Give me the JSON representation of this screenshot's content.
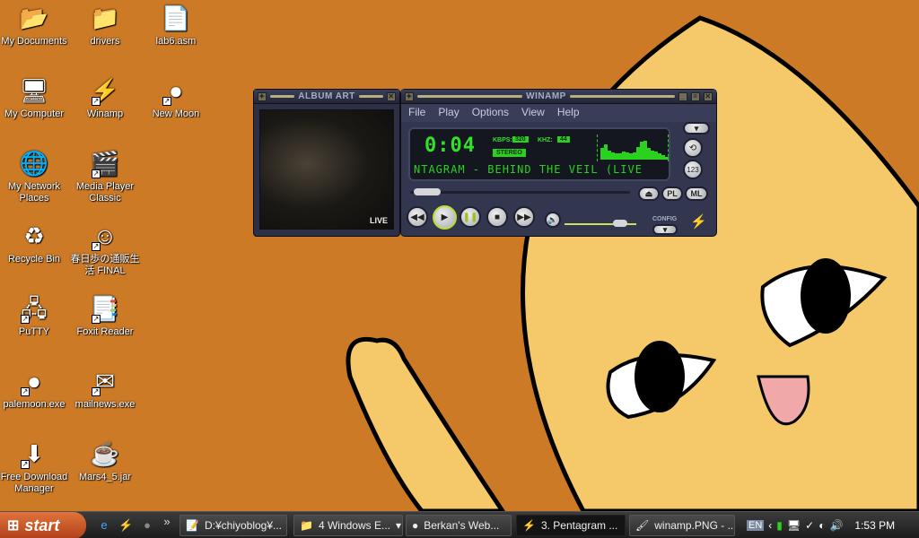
{
  "desktop": {
    "icons": [
      {
        "label": "My Documents",
        "icon": "my-documents-icon",
        "glyph": "📂",
        "shortcut": false
      },
      {
        "label": "drivers",
        "icon": "folder-icon",
        "glyph": "📁",
        "shortcut": false
      },
      {
        "label": "lab6.asm",
        "icon": "text-file-icon",
        "glyph": "📄",
        "shortcut": false
      },
      {
        "label": "My Computer",
        "icon": "my-computer-icon",
        "glyph": "🖥",
        "shortcut": false
      },
      {
        "label": "Winamp",
        "icon": "winamp-icon",
        "glyph": "⚡",
        "shortcut": true
      },
      {
        "label": "New Moon",
        "icon": "new-moon-icon",
        "glyph": "●",
        "shortcut": true
      },
      {
        "label": "My Network Places",
        "icon": "network-places-icon",
        "glyph": "🌐",
        "shortcut": false
      },
      {
        "label": "Media Player Classic",
        "icon": "media-player-classic-icon",
        "glyph": "🎬",
        "shortcut": true
      },
      {
        "label": "Recycle Bin",
        "icon": "recycle-bin-icon",
        "glyph": "♻",
        "shortcut": false
      },
      {
        "label": "春日歩の通販生活 FINAL",
        "icon": "anime-app-icon",
        "glyph": "☺",
        "shortcut": true
      },
      {
        "label": "PuTTY",
        "icon": "putty-icon",
        "glyph": "🖧",
        "shortcut": true
      },
      {
        "label": "Foxit Reader",
        "icon": "foxit-reader-icon",
        "glyph": "📑",
        "shortcut": true
      },
      {
        "label": "palemoon.exe",
        "icon": "palemoon-icon",
        "glyph": "●",
        "shortcut": true
      },
      {
        "label": "mailnews.exe",
        "icon": "mail-icon",
        "glyph": "✉",
        "shortcut": true
      },
      {
        "label": "Free Download Manager",
        "icon": "download-manager-icon",
        "glyph": "⬇",
        "shortcut": true
      },
      {
        "label": "Mars4_5.jar",
        "icon": "jar-file-icon",
        "glyph": "☕",
        "shortcut": false
      }
    ]
  },
  "album_art": {
    "title": "ALBUM ART",
    "live_label": "LIVE"
  },
  "winamp": {
    "title": "WINAMP",
    "menu": [
      "File",
      "Play",
      "Options",
      "View",
      "Help"
    ],
    "time": "0:04",
    "kbps_label": "KBPS:",
    "kbps": "320",
    "khz_label": "KHZ:",
    "khz": "44",
    "stereo": "STEREO",
    "marquee": "NTAGRAM - BEHIND THE VEIL (LIVE",
    "spectrum": [
      0.5,
      0.65,
      0.4,
      0.3,
      0.25,
      0.25,
      0.35,
      0.3,
      0.25,
      0.3,
      0.55,
      0.75,
      0.8,
      0.5,
      0.4,
      0.35,
      0.25,
      0.2,
      0.1
    ],
    "seek_position": 0.02,
    "volume": 0.85,
    "buttons": {
      "eject": "⏏",
      "pl": "PL",
      "ml": "ML",
      "prev": "◀◀",
      "play": "▶",
      "pause": "❚❚",
      "stop": "■",
      "next": "▶▶"
    },
    "config_label": "CONFIG"
  },
  "taskbar": {
    "start_label": "start",
    "quick_launch": [
      "ie-icon",
      "winamp-icon",
      "palemoon-icon"
    ],
    "overflow": "»",
    "tasks": [
      {
        "label": "D:¥chiyoblog¥...",
        "icon": "notepad-icon",
        "glyph": "📝",
        "active": false
      },
      {
        "label": "4 Windows E...",
        "icon": "folder-icon",
        "glyph": "📁",
        "active": false,
        "group": true
      },
      {
        "label": "Berkan's Web...",
        "icon": "palemoon-icon",
        "glyph": "●",
        "active": false
      },
      {
        "label": "3. Pentagram ...",
        "icon": "winamp-icon",
        "glyph": "⚡",
        "active": true
      },
      {
        "label": "winamp.PNG - ...",
        "icon": "paint-icon",
        "glyph": "🖌",
        "active": false
      }
    ],
    "language": "EN",
    "clock": "1:53 PM"
  }
}
